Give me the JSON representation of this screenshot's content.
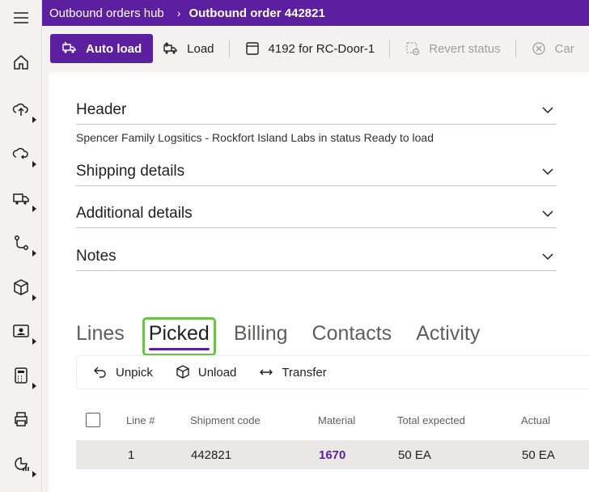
{
  "breadcrumb": {
    "parent": "Outbound orders hub",
    "separator": "›",
    "current": "Outbound order 442821"
  },
  "nav_rail": [
    "menu-icon",
    "home-icon",
    "upload-icon",
    "cloud-refresh-icon",
    "truck-icon",
    "flow-icon",
    "package-icon",
    "contact-card-icon",
    "calculator-icon",
    "print-icon",
    "report-icon"
  ],
  "commands": {
    "auto_load": "Auto load",
    "load": "Load",
    "door": "4192 for RC-Door-1",
    "revert": "Revert status",
    "cancel": "Car"
  },
  "sections": {
    "header": "Header",
    "summary": "Spencer Family Logsitics - Rockfort Island Labs in status Ready to load",
    "shipping": "Shipping details",
    "additional": "Additional details",
    "notes": "Notes"
  },
  "tabs": [
    "Lines",
    "Picked",
    "Billing",
    "Contacts",
    "Activity"
  ],
  "active_tab": "Picked",
  "grid_commands": {
    "unpick": "Unpick",
    "unload": "Unload",
    "transfer": "Transfer"
  },
  "table": {
    "columns": [
      "Line #",
      "Shipment code",
      "Material",
      "Total expected",
      "Actual"
    ],
    "rows": [
      {
        "line": "1",
        "shipment": "442821",
        "material": "1670",
        "expected": "50 EA",
        "actual": "50 EA"
      }
    ]
  },
  "colors": {
    "brand": "#5c1fa0",
    "focus": "#6cc04a",
    "row_selected": "#e9e8e7"
  }
}
